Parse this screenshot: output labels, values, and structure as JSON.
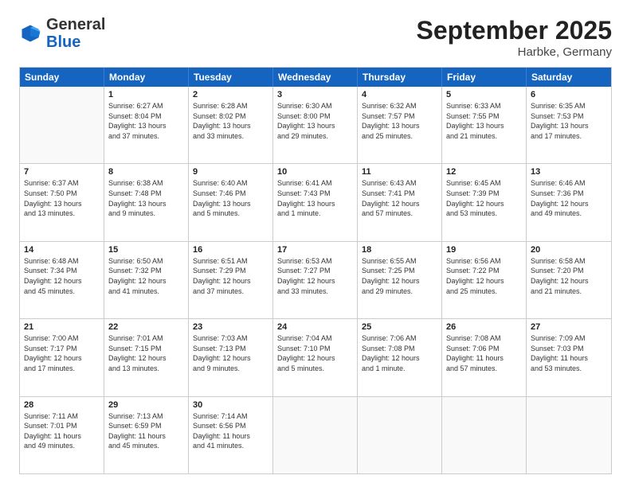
{
  "header": {
    "logo_general": "General",
    "logo_blue": "Blue",
    "month": "September 2025",
    "location": "Harbke, Germany"
  },
  "weekdays": [
    "Sunday",
    "Monday",
    "Tuesday",
    "Wednesday",
    "Thursday",
    "Friday",
    "Saturday"
  ],
  "rows": [
    [
      {
        "day": "",
        "info": ""
      },
      {
        "day": "1",
        "info": "Sunrise: 6:27 AM\nSunset: 8:04 PM\nDaylight: 13 hours\nand 37 minutes."
      },
      {
        "day": "2",
        "info": "Sunrise: 6:28 AM\nSunset: 8:02 PM\nDaylight: 13 hours\nand 33 minutes."
      },
      {
        "day": "3",
        "info": "Sunrise: 6:30 AM\nSunset: 8:00 PM\nDaylight: 13 hours\nand 29 minutes."
      },
      {
        "day": "4",
        "info": "Sunrise: 6:32 AM\nSunset: 7:57 PM\nDaylight: 13 hours\nand 25 minutes."
      },
      {
        "day": "5",
        "info": "Sunrise: 6:33 AM\nSunset: 7:55 PM\nDaylight: 13 hours\nand 21 minutes."
      },
      {
        "day": "6",
        "info": "Sunrise: 6:35 AM\nSunset: 7:53 PM\nDaylight: 13 hours\nand 17 minutes."
      }
    ],
    [
      {
        "day": "7",
        "info": "Sunrise: 6:37 AM\nSunset: 7:50 PM\nDaylight: 13 hours\nand 13 minutes."
      },
      {
        "day": "8",
        "info": "Sunrise: 6:38 AM\nSunset: 7:48 PM\nDaylight: 13 hours\nand 9 minutes."
      },
      {
        "day": "9",
        "info": "Sunrise: 6:40 AM\nSunset: 7:46 PM\nDaylight: 13 hours\nand 5 minutes."
      },
      {
        "day": "10",
        "info": "Sunrise: 6:41 AM\nSunset: 7:43 PM\nDaylight: 13 hours\nand 1 minute."
      },
      {
        "day": "11",
        "info": "Sunrise: 6:43 AM\nSunset: 7:41 PM\nDaylight: 12 hours\nand 57 minutes."
      },
      {
        "day": "12",
        "info": "Sunrise: 6:45 AM\nSunset: 7:39 PM\nDaylight: 12 hours\nand 53 minutes."
      },
      {
        "day": "13",
        "info": "Sunrise: 6:46 AM\nSunset: 7:36 PM\nDaylight: 12 hours\nand 49 minutes."
      }
    ],
    [
      {
        "day": "14",
        "info": "Sunrise: 6:48 AM\nSunset: 7:34 PM\nDaylight: 12 hours\nand 45 minutes."
      },
      {
        "day": "15",
        "info": "Sunrise: 6:50 AM\nSunset: 7:32 PM\nDaylight: 12 hours\nand 41 minutes."
      },
      {
        "day": "16",
        "info": "Sunrise: 6:51 AM\nSunset: 7:29 PM\nDaylight: 12 hours\nand 37 minutes."
      },
      {
        "day": "17",
        "info": "Sunrise: 6:53 AM\nSunset: 7:27 PM\nDaylight: 12 hours\nand 33 minutes."
      },
      {
        "day": "18",
        "info": "Sunrise: 6:55 AM\nSunset: 7:25 PM\nDaylight: 12 hours\nand 29 minutes."
      },
      {
        "day": "19",
        "info": "Sunrise: 6:56 AM\nSunset: 7:22 PM\nDaylight: 12 hours\nand 25 minutes."
      },
      {
        "day": "20",
        "info": "Sunrise: 6:58 AM\nSunset: 7:20 PM\nDaylight: 12 hours\nand 21 minutes."
      }
    ],
    [
      {
        "day": "21",
        "info": "Sunrise: 7:00 AM\nSunset: 7:17 PM\nDaylight: 12 hours\nand 17 minutes."
      },
      {
        "day": "22",
        "info": "Sunrise: 7:01 AM\nSunset: 7:15 PM\nDaylight: 12 hours\nand 13 minutes."
      },
      {
        "day": "23",
        "info": "Sunrise: 7:03 AM\nSunset: 7:13 PM\nDaylight: 12 hours\nand 9 minutes."
      },
      {
        "day": "24",
        "info": "Sunrise: 7:04 AM\nSunset: 7:10 PM\nDaylight: 12 hours\nand 5 minutes."
      },
      {
        "day": "25",
        "info": "Sunrise: 7:06 AM\nSunset: 7:08 PM\nDaylight: 12 hours\nand 1 minute."
      },
      {
        "day": "26",
        "info": "Sunrise: 7:08 AM\nSunset: 7:06 PM\nDaylight: 11 hours\nand 57 minutes."
      },
      {
        "day": "27",
        "info": "Sunrise: 7:09 AM\nSunset: 7:03 PM\nDaylight: 11 hours\nand 53 minutes."
      }
    ],
    [
      {
        "day": "28",
        "info": "Sunrise: 7:11 AM\nSunset: 7:01 PM\nDaylight: 11 hours\nand 49 minutes."
      },
      {
        "day": "29",
        "info": "Sunrise: 7:13 AM\nSunset: 6:59 PM\nDaylight: 11 hours\nand 45 minutes."
      },
      {
        "day": "30",
        "info": "Sunrise: 7:14 AM\nSunset: 6:56 PM\nDaylight: 11 hours\nand 41 minutes."
      },
      {
        "day": "",
        "info": ""
      },
      {
        "day": "",
        "info": ""
      },
      {
        "day": "",
        "info": ""
      },
      {
        "day": "",
        "info": ""
      }
    ]
  ]
}
